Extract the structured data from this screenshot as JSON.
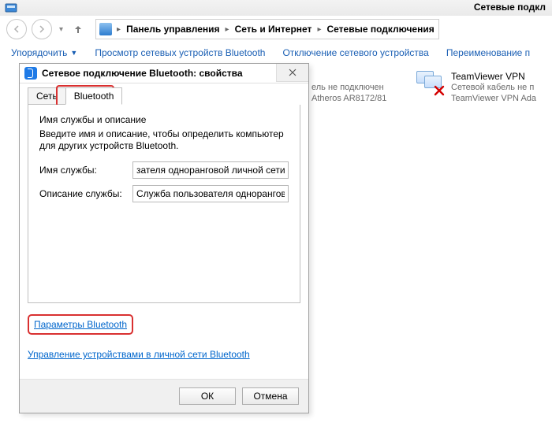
{
  "window": {
    "title": "Сетевые подкл"
  },
  "breadcrumb": {
    "items": [
      {
        "label": "Панель управления"
      },
      {
        "label": "Сеть и Интернет"
      },
      {
        "label": "Сетевые подключения"
      }
    ]
  },
  "toolbar": {
    "organize": "Упорядочить",
    "view_bluetooth": "Просмотр сетевых устройств Bluetooth",
    "disable": "Отключение сетевого устройства",
    "rename": "Переименование п"
  },
  "adapters": {
    "bluetooth_partial": {
      "status": "ель не подключен",
      "driver": "Atheros AR8172/81"
    },
    "teamviewer": {
      "name": "TeamViewer VPN",
      "status": "Сетевой кабель не п",
      "driver": "TeamViewer VPN Ada"
    }
  },
  "dialog": {
    "title": "Сетевое подключение Bluetooth: свойства",
    "tabs": {
      "network": "Сеть",
      "bluetooth": "Bluetooth"
    },
    "section": {
      "heading": "Имя службы и описание",
      "desc": "Введите имя и описание, чтобы определить компьютер для других устройств Bluetooth.",
      "name_label": "Имя службы:",
      "name_value": "зателя одноранговой личной сети",
      "desc_label": "Описание службы:",
      "desc_value": "Служба пользователя одноранговс"
    },
    "links": {
      "params": "Параметры Bluetooth",
      "manage": "Управление устройствами в личной сети Bluetooth"
    },
    "buttons": {
      "ok": "ОК",
      "cancel": "Отмена"
    }
  }
}
